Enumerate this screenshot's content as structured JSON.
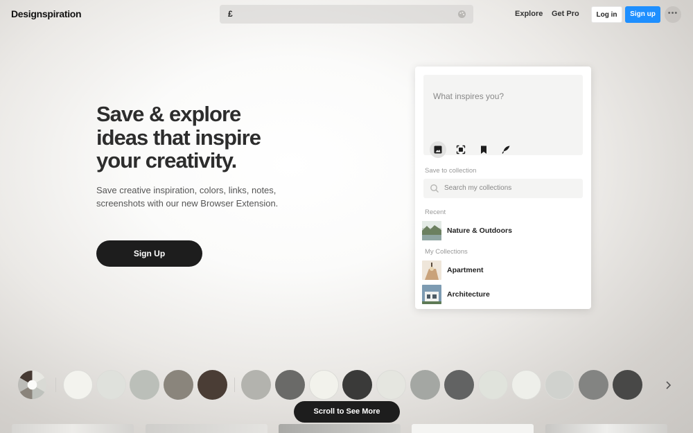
{
  "header": {
    "logo": "Designspiration",
    "search_value": "£",
    "nav": {
      "explore": "Explore",
      "get_pro": "Get Pro"
    },
    "login_label": "Log in",
    "signup_label": "Sign up",
    "more_label": "•••"
  },
  "hero": {
    "title_lines": [
      "Save & explore",
      "ideas that inspire",
      "your creativity."
    ],
    "subtitle_lines": [
      "Save creative inspiration, colors, links, notes,",
      "screenshots with our new Browser Extension."
    ],
    "cta_label": "Sign Up"
  },
  "extension": {
    "compose_placeholder": "What inspires you?",
    "tools": [
      "image-icon",
      "screenshot-icon",
      "bookmark-icon",
      "note-icon"
    ],
    "save_to_label": "Save to collection",
    "search_placeholder": "Search my collections",
    "recent_label": "Recent",
    "recent": [
      {
        "name": "Nature & Outdoors"
      }
    ],
    "my_collections_label": "My Collections",
    "collections": [
      {
        "name": "Apartment"
      },
      {
        "name": "Architecture"
      }
    ]
  },
  "swatches": {
    "group1": [
      "#f3f3ee",
      "#dfe1dc",
      "#bbbfb9",
      "#8a857c",
      "#4a3d35"
    ],
    "group2": [
      "#b3b3ae",
      "#6a6a68",
      "#f2f2ec",
      "#3a3a39",
      "#e5e6e0",
      "#a4a7a3",
      "#626363",
      "#e0e3dc",
      "#eeefea",
      "#d0d2ce",
      "#838482",
      "#484847"
    ]
  },
  "scroll_label": "Scroll to See More",
  "colors": {
    "accent": "#1e8fff",
    "dark": "#1d1d1d"
  }
}
